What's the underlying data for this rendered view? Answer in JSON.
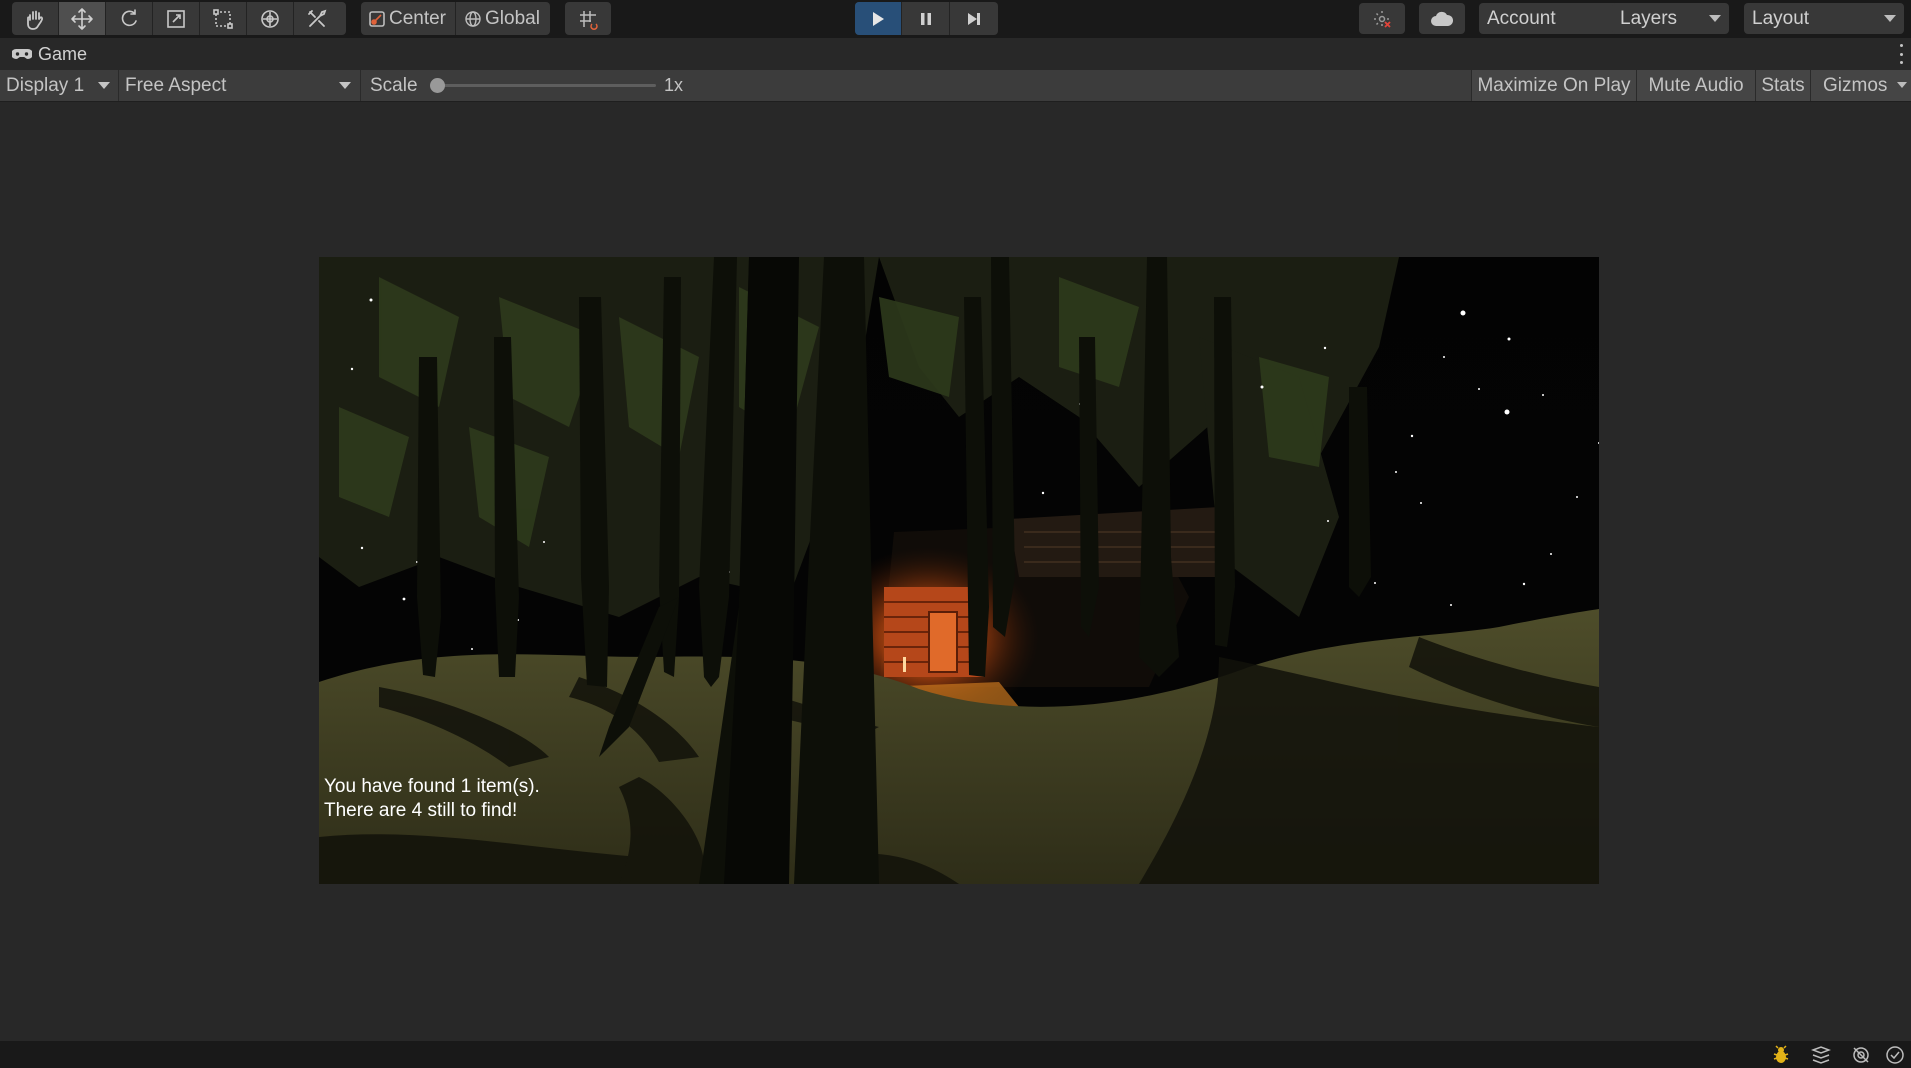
{
  "toolbar": {
    "tools": [
      {
        "name": "hand-tool",
        "icon": "hand-icon"
      },
      {
        "name": "move-tool",
        "icon": "move-icon",
        "selected": true
      },
      {
        "name": "rotate-tool",
        "icon": "rotate-icon"
      },
      {
        "name": "scale-tool",
        "icon": "scale-icon"
      },
      {
        "name": "rect-tool",
        "icon": "rect-transform-icon"
      },
      {
        "name": "transform-tool",
        "icon": "transform-icon"
      },
      {
        "name": "custom-tool",
        "icon": "custom-tool-icon"
      }
    ],
    "pivot_position_label": "Center",
    "pivot_rotation_label": "Global",
    "snap_icon": "grid-snap-icon",
    "playback": {
      "play_icon": "play-icon",
      "pause_icon": "pause-icon",
      "step_icon": "step-icon",
      "playing": true
    },
    "collab_icon": "collab-icon",
    "cloud_icon": "cloud-icon",
    "account_label": "Account",
    "layers_label": "Layers",
    "layout_label": "Layout"
  },
  "tab": {
    "label": "Game",
    "icon": "gamepad-icon"
  },
  "game_toolbar": {
    "display_label": "Display 1",
    "aspect_label": "Free Aspect",
    "scale_label": "Scale",
    "scale_value": "1x",
    "scale_fraction": 0,
    "maximize_label": "Maximize On Play",
    "mute_label": "Mute Audio",
    "stats_label": "Stats",
    "gizmos_label": "Gizmos"
  },
  "game_view": {
    "hud_line_1": "You have found 1 item(s).",
    "hud_line_2": "There are 4 still to find!"
  },
  "status_bar": {
    "icons": [
      "bug-icon",
      "layers-stack-icon",
      "auto-generate-lighting-icon",
      "check-circle-icon"
    ]
  },
  "colors": {
    "accent_play": "#284f78",
    "toolbar_bg": "#191919",
    "panel_bg": "#282828",
    "hud_text": "#ffffff"
  }
}
